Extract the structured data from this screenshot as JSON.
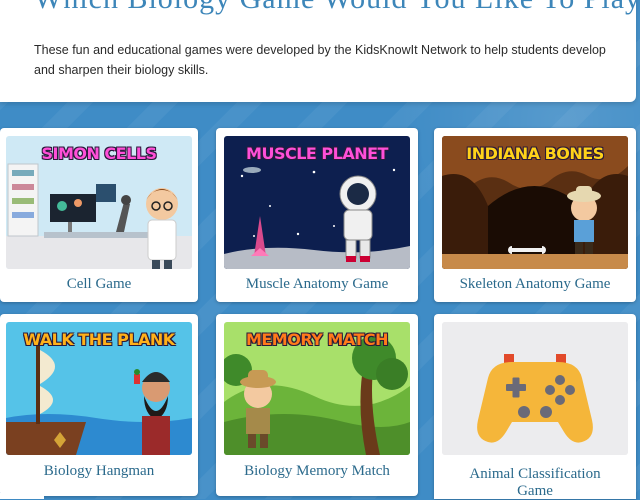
{
  "header": {
    "title": "Which Biology Game Would You Like To Play?",
    "intro": "These fun and educational games were developed by the KidsKnowIt Network to help students develop and sharpen their biology skills."
  },
  "games": [
    {
      "title": "Cell Game",
      "thumb_label": "SIMON CELLS",
      "thumb_icon": "scientist-lab-icon"
    },
    {
      "title": "Muscle Anatomy Game",
      "thumb_label": "MUSCLE PLANET",
      "thumb_icon": "astronaut-icon"
    },
    {
      "title": "Skeleton Anatomy Game",
      "thumb_label": "INDIANA BONES",
      "thumb_icon": "explorer-cave-icon"
    },
    {
      "title": "Biology Hangman",
      "thumb_label": "WALK THE PLANK",
      "thumb_icon": "pirate-ship-icon"
    },
    {
      "title": "Biology Memory Match",
      "thumb_label": "MEMORY MATCH",
      "thumb_icon": "jungle-explorer-icon"
    },
    {
      "title": "Animal Classification Game",
      "thumb_label": "",
      "thumb_icon": "gamepad-icon"
    }
  ],
  "colors": {
    "background": "#3f8cc6",
    "title": "#3d86b9",
    "card_title": "#2b6a8c"
  }
}
